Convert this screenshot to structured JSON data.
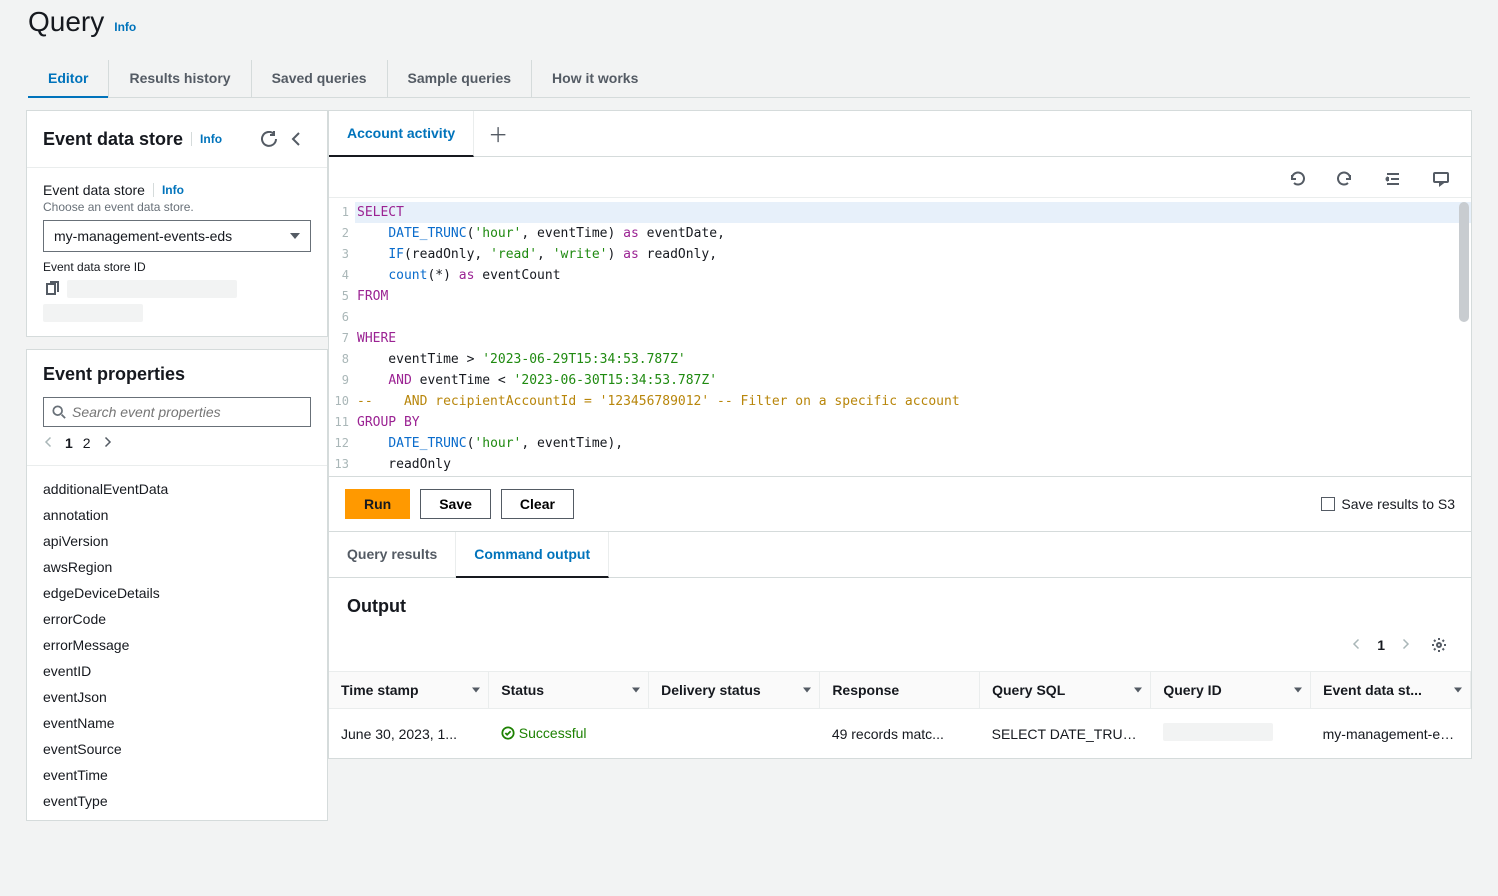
{
  "header": {
    "title": "Query",
    "info": "Info"
  },
  "top_tabs": [
    {
      "label": "Editor",
      "active": true
    },
    {
      "label": "Results history"
    },
    {
      "label": "Saved queries"
    },
    {
      "label": "Sample queries"
    },
    {
      "label": "How it works"
    }
  ],
  "sidebar": {
    "eds": {
      "title": "Event data store",
      "info": "Info",
      "field_label": "Event data store",
      "field_info": "Info",
      "hint": "Choose an event data store.",
      "selected": "my-management-events-eds",
      "id_label": "Event data store ID"
    },
    "props": {
      "title": "Event properties",
      "search_placeholder": "Search event properties",
      "pages": [
        "1",
        "2"
      ],
      "items": [
        "additionalEventData",
        "annotation",
        "apiVersion",
        "awsRegion",
        "edgeDeviceDetails",
        "errorCode",
        "errorMessage",
        "eventID",
        "eventJson",
        "eventName",
        "eventSource",
        "eventTime",
        "eventType"
      ]
    }
  },
  "main": {
    "query_tab": "Account activity",
    "code_lines": [
      [
        {
          "c": "kw",
          "t": "SELECT"
        }
      ],
      [
        {
          "t": "    "
        },
        {
          "c": "fn",
          "t": "DATE_TRUNC"
        },
        {
          "t": "("
        },
        {
          "c": "str",
          "t": "'hour'"
        },
        {
          "t": ", eventTime) "
        },
        {
          "c": "kw",
          "t": "as"
        },
        {
          "t": " eventDate,"
        }
      ],
      [
        {
          "t": "    "
        },
        {
          "c": "fn",
          "t": "IF"
        },
        {
          "t": "(readOnly, "
        },
        {
          "c": "str",
          "t": "'read'"
        },
        {
          "t": ", "
        },
        {
          "c": "str",
          "t": "'write'"
        },
        {
          "t": ") "
        },
        {
          "c": "kw",
          "t": "as"
        },
        {
          "t": " readOnly,"
        }
      ],
      [
        {
          "t": "    "
        },
        {
          "c": "fn",
          "t": "count"
        },
        {
          "t": "(*) "
        },
        {
          "c": "kw",
          "t": "as"
        },
        {
          "t": " eventCount"
        }
      ],
      [
        {
          "c": "kw",
          "t": "FROM"
        }
      ],
      [
        {
          "t": " "
        }
      ],
      [
        {
          "c": "kw",
          "t": "WHERE"
        }
      ],
      [
        {
          "t": "    eventTime > "
        },
        {
          "c": "str",
          "t": "'2023-06-29T15:34:53.787Z'"
        }
      ],
      [
        {
          "t": "    "
        },
        {
          "c": "kw",
          "t": "AND"
        },
        {
          "t": " eventTime < "
        },
        {
          "c": "str",
          "t": "'2023-06-30T15:34:53.787Z'"
        }
      ],
      [
        {
          "c": "cmt",
          "t": "--    AND recipientAccountId = '123456789012' -- Filter on a specific account"
        }
      ],
      [
        {
          "c": "kw",
          "t": "GROUP BY"
        }
      ],
      [
        {
          "t": "    "
        },
        {
          "c": "fn",
          "t": "DATE_TRUNC"
        },
        {
          "t": "("
        },
        {
          "c": "str",
          "t": "'hour'"
        },
        {
          "t": ", eventTime),"
        }
      ],
      [
        {
          "t": "    readOnly"
        }
      ]
    ],
    "buttons": {
      "run": "Run",
      "save": "Save",
      "clear": "Clear",
      "save_s3": "Save results to S3"
    },
    "result_tabs": {
      "query_results": "Query results",
      "command_output": "Command output"
    },
    "output": {
      "title": "Output",
      "page": "1",
      "columns": [
        "Time stamp",
        "Status",
        "Delivery status",
        "Response",
        "Query SQL",
        "Query ID",
        "Event data st..."
      ],
      "row": {
        "timestamp": "June 30, 2023, 1...",
        "status": "Successful",
        "delivery": "",
        "response": "49 records matc...",
        "sql": "SELECT DATE_TRUNC(",
        "query_id": "",
        "eds": "my-management-even"
      }
    }
  }
}
